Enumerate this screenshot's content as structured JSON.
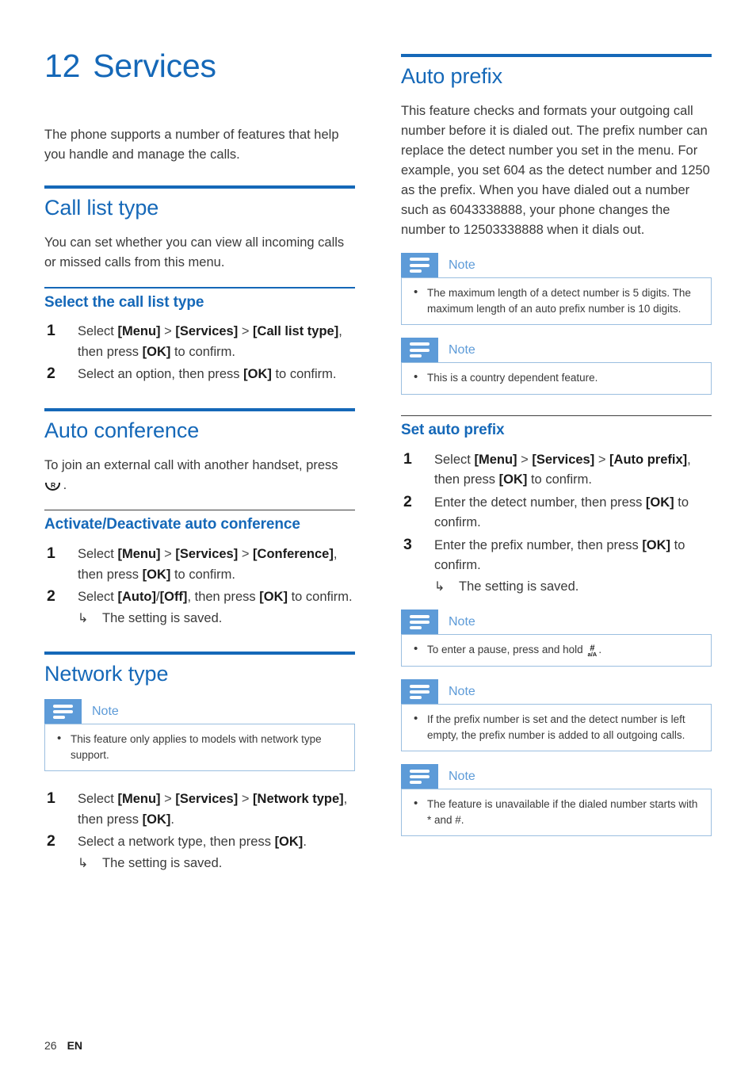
{
  "chapter": {
    "number": "12",
    "title": "Services"
  },
  "intro": "The phone supports a number of features that help you handle and manage the calls.",
  "footer": {
    "page": "26",
    "language": "EN"
  },
  "icons": {
    "note": "note-icon",
    "recall_key": "recall-key-icon",
    "hash_key": "hash-key-icon"
  },
  "colors": {
    "heading_blue": "#1568b8",
    "note_blue": "#5d9bd8",
    "note_border": "#9bbfe0",
    "body_gray": "#3a3a3a"
  },
  "left_column": {
    "call_list_type": {
      "heading": "Call list type",
      "body": "You can set whether you can view all incoming calls or missed calls from this menu.",
      "sub": {
        "heading": "Select the call list type",
        "steps": [
          {
            "num": "1",
            "parts": [
              {
                "t": "Select ",
                "b": false
              },
              {
                "t": "[Menu]",
                "b": true
              },
              {
                "t": " > ",
                "b": false
              },
              {
                "t": "[Services]",
                "b": true
              },
              {
                "t": " > ",
                "b": false
              },
              {
                "t": "[Call list type]",
                "b": true
              },
              {
                "t": ", then press ",
                "b": false
              },
              {
                "t": "[OK]",
                "b": true
              },
              {
                "t": " to confirm.",
                "b": false
              }
            ]
          },
          {
            "num": "2",
            "parts": [
              {
                "t": "Select an option, then press ",
                "b": false
              },
              {
                "t": "[OK]",
                "b": true
              },
              {
                "t": " to confirm.",
                "b": false
              }
            ]
          }
        ]
      }
    },
    "auto_conference": {
      "heading": "Auto conference",
      "body_before": "To join an external call with another handset, press ",
      "body_after": " .",
      "sub": {
        "heading": "Activate/Deactivate auto conference",
        "steps": [
          {
            "num": "1",
            "parts": [
              {
                "t": "Select ",
                "b": false
              },
              {
                "t": "[Menu]",
                "b": true
              },
              {
                "t": " > ",
                "b": false
              },
              {
                "t": "[Services]",
                "b": true
              },
              {
                "t": " > ",
                "b": false
              },
              {
                "t": "[Conference]",
                "b": true
              },
              {
                "t": ", then press ",
                "b": false
              },
              {
                "t": "[OK]",
                "b": true
              },
              {
                "t": " to confirm.",
                "b": false
              }
            ]
          },
          {
            "num": "2",
            "parts": [
              {
                "t": "Select ",
                "b": false
              },
              {
                "t": "[Auto]",
                "b": true
              },
              {
                "t": "/",
                "b": false
              },
              {
                "t": "[Off]",
                "b": true
              },
              {
                "t": ", then press ",
                "b": false
              },
              {
                "t": "[OK]",
                "b": true
              },
              {
                "t": " to confirm.",
                "b": false
              }
            ],
            "result": "The setting is saved."
          }
        ]
      }
    },
    "network_type": {
      "heading": "Network type",
      "note": {
        "title": "Note",
        "items": [
          "This feature only applies to models with network type support."
        ]
      },
      "steps": [
        {
          "num": "1",
          "parts": [
            {
              "t": "Select ",
              "b": false
            },
            {
              "t": "[Menu]",
              "b": true
            },
            {
              "t": " > ",
              "b": false
            },
            {
              "t": "[Services]",
              "b": true
            },
            {
              "t": " > ",
              "b": false
            },
            {
              "t": "[Network type]",
              "b": true
            },
            {
              "t": ", then press ",
              "b": false
            },
            {
              "t": "[OK]",
              "b": true
            },
            {
              "t": ".",
              "b": false
            }
          ]
        },
        {
          "num": "2",
          "parts": [
            {
              "t": "Select a network type, then press ",
              "b": false
            },
            {
              "t": "[OK]",
              "b": true
            },
            {
              "t": ".",
              "b": false
            }
          ],
          "result": "The setting is saved."
        }
      ]
    }
  },
  "right_column": {
    "auto_prefix": {
      "heading": "Auto prefix",
      "body": "This feature checks and formats your outgoing call number before it is dialed out. The prefix number can replace the detect number you set in the menu. For example, you set 604 as the detect number and 1250 as the prefix. When you have dialed out a number such as 6043338888, your phone changes the number to 12503338888 when it dials out.",
      "notes": [
        {
          "title": "Note",
          "items": [
            "The maximum length of a detect number is 5 digits. The maximum length of an auto prefix number is 10 digits."
          ]
        },
        {
          "title": "Note",
          "items": [
            "This is a country dependent feature."
          ]
        }
      ],
      "sub": {
        "heading": "Set auto prefix",
        "steps": [
          {
            "num": "1",
            "parts": [
              {
                "t": "Select ",
                "b": false
              },
              {
                "t": "[Menu]",
                "b": true
              },
              {
                "t": " > ",
                "b": false
              },
              {
                "t": "[Services]",
                "b": true
              },
              {
                "t": " > ",
                "b": false
              },
              {
                "t": "[Auto prefix]",
                "b": true
              },
              {
                "t": ", then press ",
                "b": false
              },
              {
                "t": "[OK]",
                "b": true
              },
              {
                "t": " to confirm.",
                "b": false
              }
            ]
          },
          {
            "num": "2",
            "parts": [
              {
                "t": "Enter the detect number, then press ",
                "b": false
              },
              {
                "t": "[OK]",
                "b": true
              },
              {
                "t": " to confirm.",
                "b": false
              }
            ]
          },
          {
            "num": "3",
            "parts": [
              {
                "t": "Enter the prefix number, then press ",
                "b": false
              },
              {
                "t": "[OK]",
                "b": true
              },
              {
                "t": " to confirm.",
                "b": false
              }
            ],
            "result": "The setting is saved."
          }
        ]
      },
      "notes_after": [
        {
          "title": "Note",
          "prefix": "To enter a pause, press and hold ",
          "glyph": "hash-key-icon",
          "suffix": "."
        },
        {
          "title": "Note",
          "items": [
            "If the prefix number is set and the detect number is left empty, the prefix number is added to all outgoing calls."
          ]
        },
        {
          "title": "Note",
          "items": [
            "The feature is unavailable if the dialed number starts with * and #."
          ]
        }
      ]
    }
  }
}
